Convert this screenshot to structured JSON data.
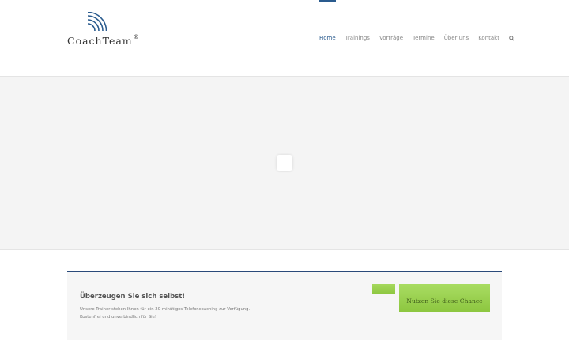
{
  "brand": {
    "name": "CoachTeam",
    "registered_mark": "®",
    "color": "#2a5b8e"
  },
  "nav": {
    "items": [
      {
        "label": "Home",
        "active": true
      },
      {
        "label": "Trainings",
        "active": false
      },
      {
        "label": "Vorträge",
        "active": false
      },
      {
        "label": "Termine",
        "active": false
      },
      {
        "label": "Über uns",
        "active": false
      },
      {
        "label": "Kontakt",
        "active": false
      }
    ],
    "search_icon": "search-icon"
  },
  "slider": {
    "loading_icon": "loader-icon"
  },
  "cta": {
    "title": "Überzeugen Sie sich selbst!",
    "line1": "Unsere Trainer stehen Ihnen für ein 20-minütiges Telefoncoaching zur Verfügung.",
    "line2": "Kostenfrei und unverbindlich für Sie!",
    "button_label": "Nutzen Sie diese Chance",
    "accent_color": "#8cc63f",
    "border_color": "#2a4a7a"
  }
}
